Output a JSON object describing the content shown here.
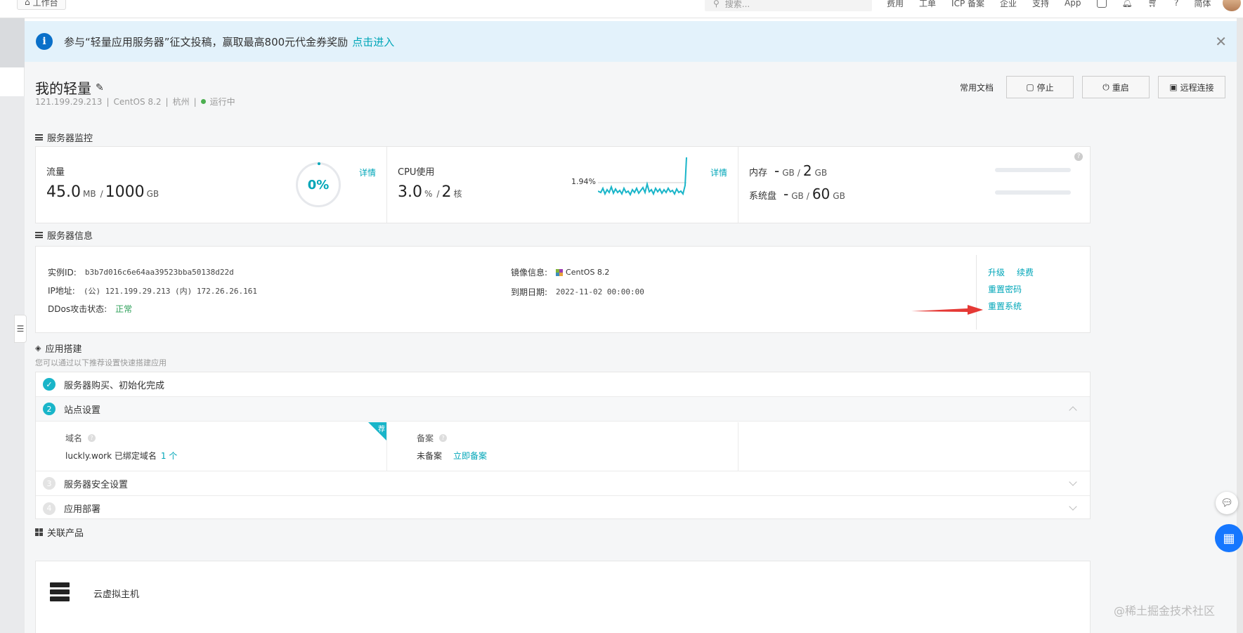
{
  "topbar": {
    "workbench": "工作台",
    "search_placeholder": "搜索...",
    "nav": [
      "费用",
      "工单",
      "ICP 备案",
      "企业",
      "支持",
      "App"
    ],
    "lang": "简体"
  },
  "notice": {
    "text": "参与“轻量应用服务器”征文投稿，赢取最高800元代金券奖励",
    "link": "点击进入"
  },
  "header": {
    "title": "我的轻量",
    "ip": "121.199.29.213",
    "os": "CentOS 8.2",
    "region": "杭州",
    "status": "运行中",
    "doc": "常用文档",
    "stop": "停止",
    "restart": "重启",
    "remote": "远程连接"
  },
  "monitor": {
    "section_title": "服务器监控",
    "traffic": {
      "label": "流量",
      "used": "45.0",
      "used_unit": "MB",
      "total": "1000",
      "total_unit": "GB",
      "percent": "0%",
      "detail": "详情"
    },
    "cpu": {
      "label": "CPU使用",
      "value": "3.0",
      "unit": "%",
      "cores": "2",
      "cores_unit": "核",
      "current": "1.94%",
      "detail": "详情"
    },
    "memory": {
      "label": "内存",
      "used": "-",
      "used_unit": "GB",
      "total": "2",
      "total_unit": "GB"
    },
    "disk": {
      "label": "系统盘",
      "used": "-",
      "used_unit": "GB",
      "total": "60",
      "total_unit": "GB"
    }
  },
  "info": {
    "section_title": "服务器信息",
    "instance_id_label": "实例ID:",
    "instance_id": "b3b7d016c6e64aa39523bba50138d22d",
    "ip_label": "IP地址:",
    "ip_value": "(公) 121.199.29.213 (内) 172.26.26.161",
    "ddos_label": "DDos攻击状态:",
    "ddos_value": "正常",
    "image_label": "镜像信息:",
    "image_value": "CentOS 8.2",
    "expire_label": "到期日期:",
    "expire_value": "2022-11-02 00:00:00",
    "upgrade": "升级",
    "renew": "续费",
    "reset_password": "重置密码",
    "reset_system": "重置系统"
  },
  "app": {
    "section_title": "应用搭建",
    "subtitle": "您可以通过以下推荐设置快速搭建应用",
    "steps": [
      {
        "num": "✓",
        "label": "服务器购买、初始化完成"
      },
      {
        "num": "2",
        "label": "站点设置"
      },
      {
        "num": "3",
        "label": "服务器安全设置"
      },
      {
        "num": "4",
        "label": "应用部署"
      }
    ],
    "domain_label": "域名",
    "domain_value": "luckly.work 已绑定域名",
    "domain_count": "1 个",
    "recommend": "荐",
    "beian_label": "备案",
    "beian_value": "未备案",
    "beian_link": "立即备案"
  },
  "related": {
    "section_title": "关联产品",
    "item": "云虚拟主机"
  },
  "watermark": "@稀土掘金技术社区"
}
